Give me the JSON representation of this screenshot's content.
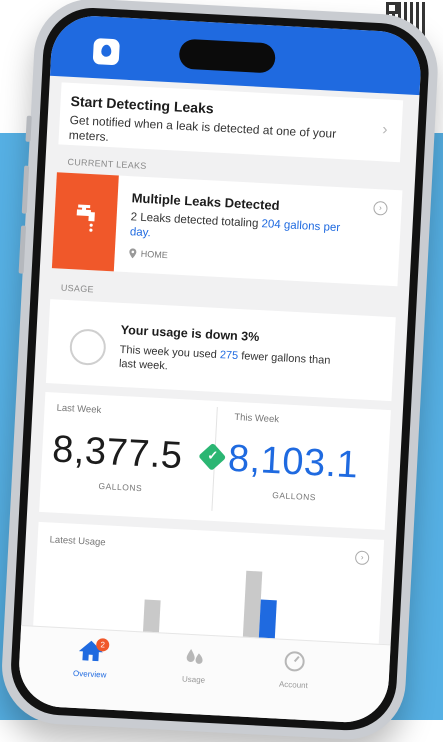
{
  "alert": {
    "title": "Start Detecting Leaks",
    "text": "Get notified when a leak is detected at one of your meters."
  },
  "current_leaks": {
    "section_label": "CURRENT LEAKS",
    "title": "Multiple Leaks Detected",
    "text_prefix": "2 Leaks detected totaling ",
    "gallons": "204 gallons",
    "text_suffix": " per day.",
    "location": "HOME"
  },
  "usage": {
    "section_label": "USAGE",
    "title": "Your usage is down 3%",
    "text_prefix": "This week you used ",
    "amount": "275",
    "text_suffix": " fewer gallons than last week."
  },
  "comparison": {
    "last_week_label": "Last Week",
    "last_week_value": "8,377.5",
    "this_week_label": "This Week",
    "this_week_value": "8,103.1",
    "unit": "GALLONS"
  },
  "latest_usage": {
    "title": "Latest Usage"
  },
  "nav": {
    "overview": "Overview",
    "usage": "Usage",
    "account": "Account",
    "badge": "2"
  },
  "colors": {
    "primary": "#1f6ae0",
    "leak_orange": "#f0582a",
    "background": "#56b0e4",
    "success": "#2bb673"
  }
}
